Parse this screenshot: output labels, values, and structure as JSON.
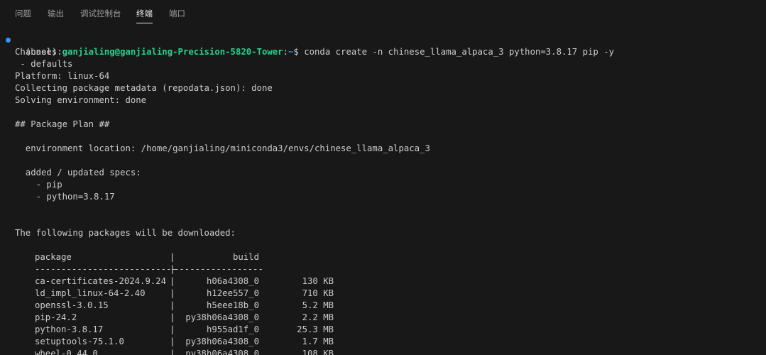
{
  "panel": {
    "tabs": [
      "问题",
      "输出",
      "调试控制台",
      "终端",
      "端口"
    ],
    "active_tab": "终端"
  },
  "terminal": {
    "prompt": {
      "env": "(base) ",
      "user_host": "ganjialing@ganjialing-Precision-5820-Tower",
      "colon": ":",
      "path": "~",
      "symbol": "$ ",
      "command": "conda create -n chinese_llama_alpaca_3 python=3.8.17 pip -y"
    },
    "lines": [
      "Channels:",
      " - defaults",
      "Platform: linux-64",
      "Collecting package metadata (repodata.json): done",
      "Solving environment: done",
      "",
      "## Package Plan ##",
      "",
      "  environment location: /home/ganjialing/miniconda3/envs/chinese_llama_alpaca_3",
      "",
      "  added / updated specs:",
      "    - pip",
      "    - python=3.8.17",
      "",
      "",
      "The following packages will be downloaded:"
    ],
    "table": {
      "header_package": "package",
      "header_build": "build",
      "sep": "|",
      "rule_left": "---------------------------",
      "rule_right": "-----------------",
      "rows": [
        {
          "package": "ca-certificates-2024.9.24",
          "build": "h06a4308_0",
          "size": "130 KB"
        },
        {
          "package": "ld_impl_linux-64-2.40",
          "build": "h12ee557_0",
          "size": "710 KB"
        },
        {
          "package": "openssl-3.0.15",
          "build": "h5eee18b_0",
          "size": "5.2 MB"
        },
        {
          "package": "pip-24.2",
          "build": "py38h06a4308_0",
          "size": "2.2 MB"
        },
        {
          "package": "python-3.8.17",
          "build": "h955ad1f_0",
          "size": "25.3 MB"
        },
        {
          "package": "setuptools-75.1.0",
          "build": "py38h06a4308_0",
          "size": "1.7 MB"
        },
        {
          "package": "wheel-0.44.0",
          "build": "py38h06a4308_0",
          "size": "108 KB"
        }
      ]
    }
  }
}
